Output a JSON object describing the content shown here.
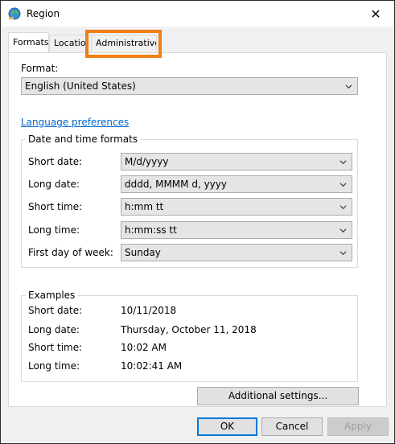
{
  "window": {
    "title": "Region",
    "close_glyph": "✕"
  },
  "tabs": [
    {
      "label": "Formats",
      "active": true
    },
    {
      "label": "Location",
      "active": false
    },
    {
      "label": "Administrative",
      "active": false,
      "highlighted": true
    }
  ],
  "highlight_color": "#f07d17",
  "format": {
    "label": "Format:",
    "value": "English (United States)"
  },
  "language_link": "Language preferences",
  "date_time": {
    "title": "Date and time formats",
    "rows": [
      {
        "label": "Short date:",
        "value": "M/d/yyyy"
      },
      {
        "label": "Long date:",
        "value": "dddd, MMMM d, yyyy"
      },
      {
        "label": "Short time:",
        "value": "h:mm tt"
      },
      {
        "label": "Long time:",
        "value": "h:mm:ss tt"
      },
      {
        "label": "First day of week:",
        "value": "Sunday"
      }
    ]
  },
  "examples": {
    "title": "Examples",
    "rows": [
      {
        "label": "Short date:",
        "value": "10/11/2018"
      },
      {
        "label": "Long date:",
        "value": "Thursday, October 11, 2018"
      },
      {
        "label": "Short time:",
        "value": "10:02 AM"
      },
      {
        "label": "Long time:",
        "value": "10:02:41 AM"
      }
    ]
  },
  "buttons": {
    "additional": "Additional settings...",
    "ok": "OK",
    "cancel": "Cancel",
    "apply": "Apply"
  },
  "icons": {
    "title": "globe-icon",
    "close": "close-icon",
    "dropdown": "chevron-down-icon"
  },
  "colors": {
    "link": "#0066cc",
    "ok_border": "#0078d7"
  }
}
